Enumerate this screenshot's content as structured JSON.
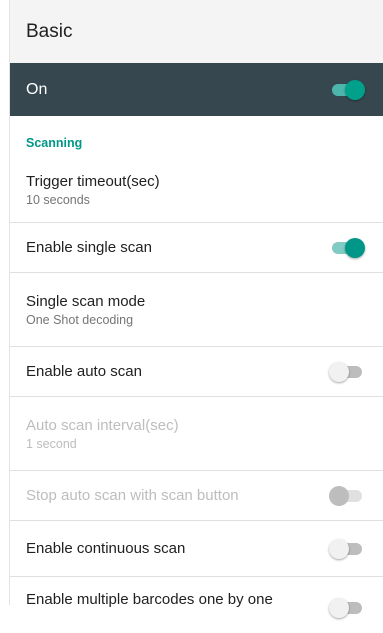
{
  "header": {
    "title": "Basic"
  },
  "master_switch": {
    "label": "On",
    "state": "on"
  },
  "section": {
    "title": "Scanning"
  },
  "items": [
    {
      "title": "Trigger timeout(sec)",
      "summary": "10 seconds"
    },
    {
      "title": "Enable single scan",
      "switch": "on"
    },
    {
      "title": "Single scan mode",
      "summary": "One Shot decoding"
    },
    {
      "title": "Enable auto scan",
      "switch": "off"
    },
    {
      "title": "Auto scan interval(sec)",
      "summary": "1 second",
      "enabled": false
    },
    {
      "title": "Stop auto scan with scan button",
      "switch": "off",
      "enabled": false
    },
    {
      "title": "Enable continuous scan",
      "switch": "off"
    },
    {
      "title": "Enable multiple barcodes one by one",
      "switch": "off"
    }
  ],
  "colors": {
    "accent": "#009688",
    "master_bar": "#37474f",
    "title_bar": "#f4f4f4"
  }
}
